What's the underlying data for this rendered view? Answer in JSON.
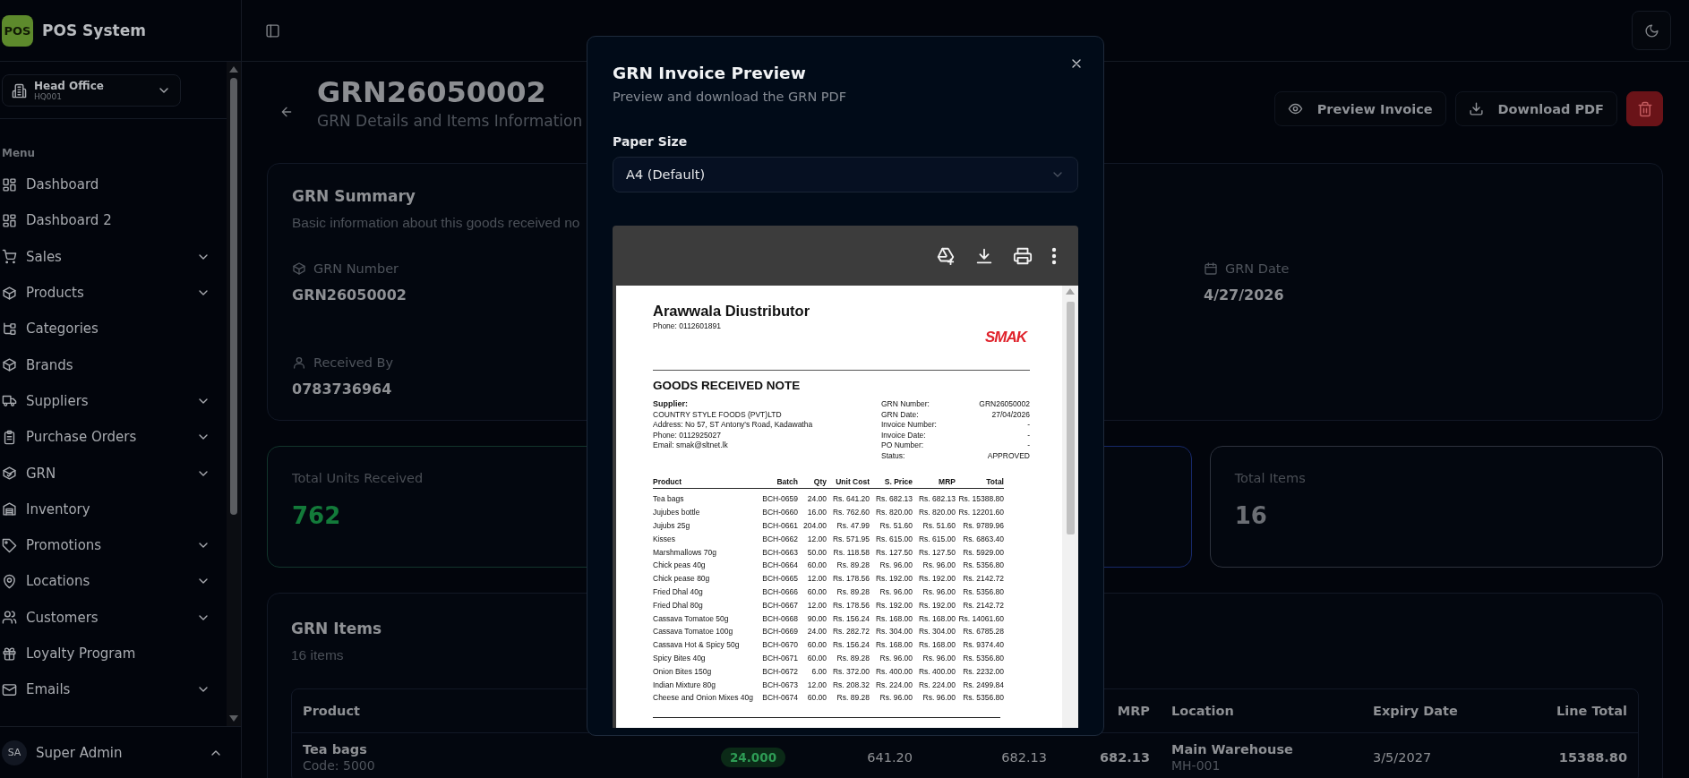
{
  "app": {
    "logo": "POS",
    "name": "POS System"
  },
  "branch": {
    "name": "Head Office",
    "code": "HQ001"
  },
  "sidebar": {
    "heading": "Menu",
    "items": [
      {
        "label": "Dashboard",
        "kind": "link"
      },
      {
        "label": "Dashboard 2",
        "kind": "link"
      },
      {
        "label": "Sales",
        "kind": "group"
      },
      {
        "label": "Products",
        "kind": "group"
      },
      {
        "label": "Categories",
        "kind": "link"
      },
      {
        "label": "Brands",
        "kind": "link"
      },
      {
        "label": "Suppliers",
        "kind": "group"
      },
      {
        "label": "Purchase Orders",
        "kind": "group"
      },
      {
        "label": "GRN",
        "kind": "group"
      },
      {
        "label": "Inventory",
        "kind": "link"
      },
      {
        "label": "Promotions",
        "kind": "group"
      },
      {
        "label": "Locations",
        "kind": "group"
      },
      {
        "label": "Customers",
        "kind": "group"
      },
      {
        "label": "Loyalty Program",
        "kind": "link"
      },
      {
        "label": "Emails",
        "kind": "group"
      }
    ]
  },
  "user": {
    "initials": "SA",
    "name": "Super Admin"
  },
  "page": {
    "title": "GRN26050002",
    "subtitle": "GRN Details and Items Information",
    "actions": [
      {
        "kind": "preview",
        "label": "Preview Invoice"
      },
      {
        "kind": "download",
        "label": "Download PDF"
      },
      {
        "kind": "delete"
      }
    ]
  },
  "summary": {
    "title": "GRN Summary",
    "subtitle": "Basic information about this goods received no",
    "fields": [
      {
        "kind": "number",
        "label": "GRN Number",
        "value": "GRN26050002"
      },
      {
        "kind": "date",
        "label": "GRN Date",
        "value": "4/27/2026"
      },
      {
        "kind": "user",
        "label": "Received By",
        "value": "0783736964"
      }
    ]
  },
  "stats": [
    {
      "color": "#137a3a",
      "label": "Total Units Received",
      "value": "762"
    },
    {
      "color": "#17296a"
    },
    {
      "color": "#6b6e74",
      "label": "Total Items",
      "value": "16"
    }
  ],
  "items": {
    "title": "GRN Items",
    "subtitle": "16 items",
    "columns": [
      {
        "kind": "text",
        "label": "Product"
      },
      {
        "kind": "hidden"
      },
      {
        "kind": "hidden"
      },
      {
        "kind": "hidden"
      },
      {
        "kind": "text",
        "label": "MRP"
      },
      {
        "kind": "text",
        "label": "Location"
      },
      {
        "kind": "text",
        "label": "Expiry Date"
      },
      {
        "kind": "text",
        "label": "Line Total"
      }
    ],
    "rows": [
      {
        "product": "Tea bags",
        "code": "Code: 5000",
        "column_2": "24.000",
        "column_3": "641.20",
        "column_4": "682.13",
        "mrp": "682.13",
        "location": "Main Warehouse",
        "location_code": "MH-001",
        "expiry_date": "3/5/2027",
        "line_total": "15388.80"
      }
    ]
  },
  "modal": {
    "title": "GRN Invoice Preview",
    "subtitle": "Preview and download the GRN PDF",
    "paper_size": {
      "label": "Paper Size",
      "value": "A4 (Default)"
    },
    "document": {
      "company": "Arawwala Diustributor",
      "phone": "Phone: 0112601891",
      "logo": "SMAK",
      "title": "GOODS RECEIVED NOTE",
      "supplier_label": "Supplier:",
      "supplier_lines": [
        "COUNTRY STYLE FOODS (PVT)LTD",
        "Address: No 57, ST Antony's Road, Kadawatha",
        "Phone: 0112925027",
        "Email: smak@sltnet.lk"
      ],
      "details": [
        {
          "label": "GRN Number:",
          "value": "GRN26050002"
        },
        {
          "label": "GRN Date:",
          "value": "27/04/2026"
        },
        {
          "label": "Invoice Number:",
          "value": "-"
        },
        {
          "label": "Invoice Date:",
          "value": "-"
        },
        {
          "label": "PO Number:",
          "value": "-"
        },
        {
          "label": "Status:",
          "value": "APPROVED"
        }
      ],
      "columns": [
        "Product",
        "Batch",
        "Qty",
        "Unit Cost",
        "S. Price",
        "MRP",
        "Total"
      ],
      "rows": [
        [
          "Tea bags",
          "BCH-0659",
          "24.00",
          "Rs. 641.20",
          "Rs. 682.13",
          "Rs. 682.13",
          "Rs. 15388.80"
        ],
        [
          "Jujubes bottle",
          "BCH-0660",
          "16.00",
          "Rs. 762.60",
          "Rs. 820.00",
          "Rs. 820.00",
          "Rs. 12201.60"
        ],
        [
          "Jujubs 25g",
          "BCH-0661",
          "204.00",
          "Rs. 47.99",
          "Rs. 51.60",
          "Rs. 51.60",
          "Rs. 9789.96"
        ],
        [
          "Kisses",
          "BCH-0662",
          "12.00",
          "Rs. 571.95",
          "Rs. 615.00",
          "Rs. 615.00",
          "Rs. 6863.40"
        ],
        [
          "Marshmallows 70g",
          "BCH-0663",
          "50.00",
          "Rs. 118.58",
          "Rs. 127.50",
          "Rs. 127.50",
          "Rs. 5929.00"
        ],
        [
          "Chick peas 40g",
          "BCH-0664",
          "60.00",
          "Rs. 89.28",
          "Rs. 96.00",
          "Rs. 96.00",
          "Rs. 5356.80"
        ],
        [
          "Chick pease 80g",
          "BCH-0665",
          "12.00",
          "Rs. 178.56",
          "Rs. 192.00",
          "Rs. 192.00",
          "Rs. 2142.72"
        ],
        [
          "Fried Dhal 40g",
          "BCH-0666",
          "60.00",
          "Rs. 89.28",
          "Rs. 96.00",
          "Rs. 96.00",
          "Rs. 5356.80"
        ],
        [
          "Fried Dhal 80g",
          "BCH-0667",
          "12.00",
          "Rs. 178.56",
          "Rs. 192.00",
          "Rs. 192.00",
          "Rs. 2142.72"
        ],
        [
          "Cassava Tomatoe 50g",
          "BCH-0668",
          "90.00",
          "Rs. 156.24",
          "Rs. 168.00",
          "Rs. 168.00",
          "Rs. 14061.60"
        ],
        [
          "Cassava Tomatoe 100g",
          "BCH-0669",
          "24.00",
          "Rs. 282.72",
          "Rs. 304.00",
          "Rs. 304.00",
          "Rs. 6785.28"
        ],
        [
          "Cassava Hot & Spicy 50g",
          "BCH-0670",
          "60.00",
          "Rs. 156.24",
          "Rs. 168.00",
          "Rs. 168.00",
          "Rs. 9374.40"
        ],
        [
          "Spicy Bites 40g",
          "BCH-0671",
          "60.00",
          "Rs. 89.28",
          "Rs. 96.00",
          "Rs. 96.00",
          "Rs. 5356.80"
        ],
        [
          "Onion Bites 150g",
          "BCH-0672",
          "6.00",
          "Rs. 372.00",
          "Rs. 400.00",
          "Rs. 400.00",
          "Rs. 2232.00"
        ],
        [
          "Indian Mixture 80g",
          "BCH-0673",
          "12.00",
          "Rs. 208.32",
          "Rs. 224.00",
          "Rs. 224.00",
          "Rs. 2499.84"
        ],
        [
          "Cheese and Onion Mixes 40g",
          "BCH-0674",
          "60.00",
          "Rs. 89.28",
          "Rs. 96.00",
          "Rs. 96.00",
          "Rs. 5356.80"
        ]
      ]
    }
  }
}
